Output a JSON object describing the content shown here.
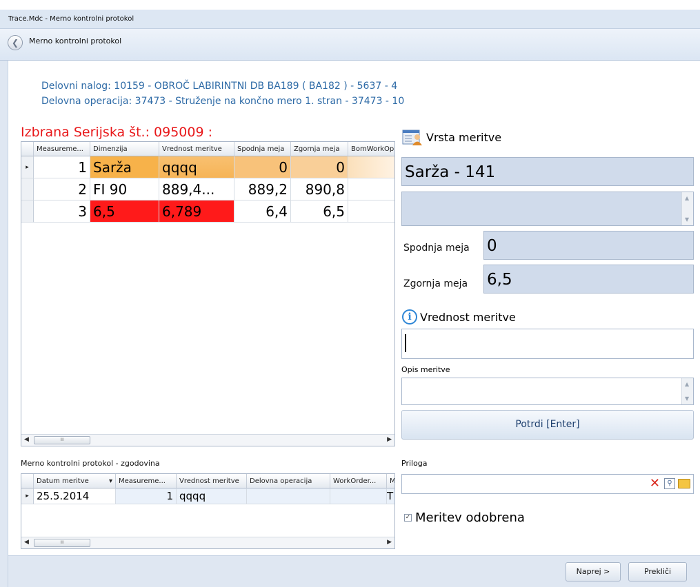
{
  "window": {
    "title": "Trace.Mdc - Merno kontrolni protokol"
  },
  "nav": {
    "title": "Merno kontrolni protokol"
  },
  "info": {
    "delovni_nalog": "Delovni nalog: 10159 - OBROČ LABIRINTNI DB BA189 ( BA182 ) - 5637 - 4",
    "delovna_operacija": "Delovna operacija: 37473 - Struženje na končno mero 1. stran - 37473 - 10"
  },
  "serial": "Izbrana Serijska št.: 095009 :",
  "grid": {
    "headers": [
      "Measureme...",
      "Dimenzija",
      "Vrednost meritve",
      "Spodnja meja",
      "Zgornja meja",
      "BomWorkOp"
    ],
    "rows": [
      {
        "marker": "▸",
        "measurement": "1",
        "dimenzija": "Sarža",
        "vrednost": "qqqq",
        "spodnja": "0",
        "zgornja": "0"
      },
      {
        "marker": "",
        "measurement": "2",
        "dimenzija": "FI 90",
        "vrednost": "889,4...",
        "spodnja": "889,2",
        "zgornja": "890,8"
      },
      {
        "marker": "",
        "measurement": "3",
        "dimenzija": "6,5",
        "vrednost": "6,789",
        "spodnja": "6,4",
        "zgornja": "6,5"
      }
    ],
    "scroll_left": "◀",
    "scroll_right": "▶",
    "thumb": "III"
  },
  "history": {
    "label": "Merno kontrolni protokol - zgodovina",
    "headers": [
      "Datum meritve",
      "Measureme...",
      "Vrednost meritve",
      "Delovna operacija",
      "WorkOrder...",
      "M"
    ],
    "sort_arrow": "▾",
    "rows": [
      {
        "marker": "▸",
        "datum": "25.5.2014",
        "measurement": "1",
        "vrednost": "qqqq",
        "operacija": "",
        "workorder": "",
        "m": "T"
      }
    ]
  },
  "right": {
    "vrsta_label": "Vrsta meritve",
    "sarza_value": "Sarža - 141",
    "spodnja_label": "Spodnja meja",
    "spodnja_value": "0",
    "zgornja_label": "Zgornja meja",
    "zgornja_value": "6,5",
    "info_glyph": "i",
    "vrednost_label": "Vrednost meritve",
    "vrednost_value": "",
    "opis_label": "Opis meritve",
    "potrdi_label": "Potrdi [Enter]",
    "priloga_label": "Priloga",
    "checkbox_mark": "✓",
    "odobrena_label": "Meritev odobrena",
    "scroll_up": "▲",
    "scroll_down": "▼"
  },
  "footer": {
    "next_label": "Naprej >",
    "cancel_label": "Prekliči"
  },
  "colors": {
    "accent_orange": "#f7b24a",
    "error_red": "#ff1a1a",
    "info_blue": "#2d6aa6"
  }
}
